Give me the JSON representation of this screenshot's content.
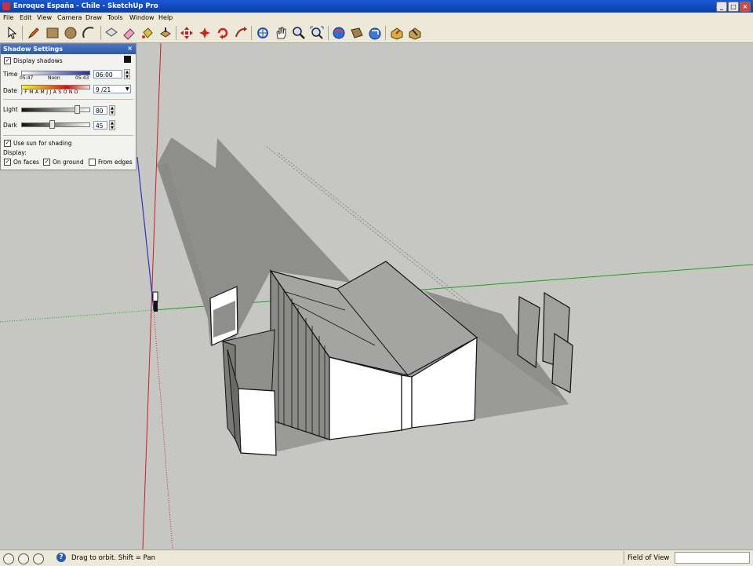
{
  "window": {
    "title": "Enroque España - Chile - SketchUp Pro",
    "buttons": {
      "minimize": "_",
      "maximize": "□",
      "close": "×"
    }
  },
  "menu": [
    "File",
    "Edit",
    "View",
    "Camera",
    "Draw",
    "Tools",
    "Window",
    "Help"
  ],
  "toolbar": {
    "icons": [
      "select-icon",
      "pencil-icon",
      "rectangle-icon",
      "circle-icon",
      "arc-icon",
      "make-component-icon",
      "eraser-icon",
      "paint-bucket-icon",
      "push-pull-icon",
      "move-icon",
      "rotate-icon",
      "follow-me-icon",
      "orbit-icon",
      "pan-icon",
      "zoom-icon",
      "zoom-extents-icon",
      "3d-warehouse-icon",
      "get-models-icon",
      "share-model-icon",
      "components-icon",
      "materials-icon"
    ]
  },
  "shadow_panel": {
    "title": "Shadow Settings",
    "close": "×",
    "display_shadows": {
      "label": "Display shadows",
      "checked": true
    },
    "time": {
      "label": "Time",
      "start": "05:47",
      "mid": "Noon",
      "end": "05:43",
      "value": "06:00"
    },
    "date": {
      "label": "Date",
      "months": "J F M A M J J A S O N D",
      "value": "9 /21"
    },
    "light": {
      "label": "Light",
      "value": "80"
    },
    "dark": {
      "label": "Dark",
      "value": "45"
    },
    "use_sun": {
      "label": "Use sun for shading",
      "checked": true
    },
    "display_label": "Display:",
    "on_faces": {
      "label": "On faces",
      "checked": true
    },
    "on_ground": {
      "label": "On ground",
      "checked": true
    },
    "from_edges": {
      "label": "From edges",
      "checked": false
    }
  },
  "status": {
    "hint": "Drag to orbit.  Shift = Pan",
    "measure_label": "Field of View"
  },
  "colors": {
    "background": "#c6c6c2",
    "shadow": "#8e8e8c",
    "red_axis": "#cc2020",
    "green_axis": "#20a020",
    "blue_axis": "#3030c0"
  }
}
